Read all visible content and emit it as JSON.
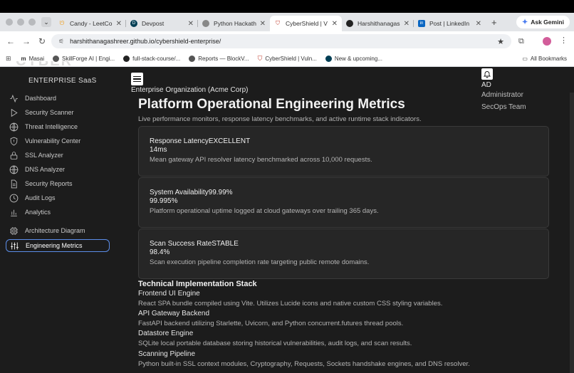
{
  "browser": {
    "tabs": [
      {
        "title": "Candy - LeetCo",
        "icon": "leetcode-icon"
      },
      {
        "title": "Devpost",
        "icon": "devpost-icon"
      },
      {
        "title": "Python Hackath",
        "icon": "python-icon"
      },
      {
        "title": "CyberShield | V",
        "icon": "shield-icon"
      },
      {
        "title": "Harshithanagas",
        "icon": "github-icon"
      },
      {
        "title": "Post | LinkedIn",
        "icon": "linkedin-icon"
      }
    ],
    "active_tab": 3,
    "ask_gemini": "Ask Gemini",
    "url": "harshithanagashreer.github.io/cybershield-enterprise/",
    "bookmarks": [
      "Masai",
      "SkillForge AI | Engi...",
      "full-stack-course/...",
      "Reports — BlockV...",
      "CyberShield | Vuln...",
      "New & upcoming..."
    ],
    "all_bookmarks": "All Bookmarks"
  },
  "sidebar": {
    "brand_sub": "ENTERPRISE SaaS",
    "items": [
      {
        "label": "Dashboard",
        "icon": "activity-icon"
      },
      {
        "label": "Security Scanner",
        "icon": "play-icon"
      },
      {
        "label": "Threat Intelligence",
        "icon": "globe-icon"
      },
      {
        "label": "Vulnerability Center",
        "icon": "alert-shield-icon"
      },
      {
        "label": "SSL Analyzer",
        "icon": "lock-icon"
      },
      {
        "label": "DNS Analyzer",
        "icon": "globe-icon"
      },
      {
        "label": "Security Reports",
        "icon": "file-icon"
      },
      {
        "label": "Audit Logs",
        "icon": "clock-icon"
      },
      {
        "label": "Analytics",
        "icon": "bar-chart-icon"
      },
      {
        "label": "Architecture Diagram",
        "icon": "cpu-icon"
      },
      {
        "label": "Engineering Metrics",
        "icon": "sliders-icon"
      }
    ],
    "active_index": 10
  },
  "header": {
    "org": "Enterprise Organization (Acme Corp)",
    "user_initials": "AD",
    "user_role": "Administrator",
    "user_team": "SecOps Team"
  },
  "page": {
    "title": "Platform Operational Engineering Metrics",
    "subtitle": "Live performance monitors, response latency benchmarks, and active runtime stack indicators.",
    "cards": [
      {
        "title": "Response LatencyEXCELLENT",
        "value": "14ms",
        "desc": "Mean gateway API resolver latency benchmarked across 10,000 requests."
      },
      {
        "title": "System Availability99.99%",
        "value": "99.995%",
        "desc": "Platform operational uptime logged at cloud gateways over trailing 365 days."
      },
      {
        "title": "Scan Success RateSTABLE",
        "value": "98.4%",
        "desc": "Scan execution pipeline completion rate targeting public remote domains."
      }
    ],
    "stack_title": "Technical Implementation Stack",
    "stack": [
      {
        "name": "Frontend UI Engine",
        "desc": "React SPA bundle compiled using Vite. Utilizes Lucide icons and native custom CSS styling variables."
      },
      {
        "name": "API Gateway Backend",
        "desc": "FastAPI backend utilizing Starlette, Uvicorn, and Python concurrent.futures thread pools."
      },
      {
        "name": "Datastore Engine",
        "desc": "SQLite local portable database storing historical vulnerabilities, audit logs, and scan results."
      },
      {
        "name": "Scanning Pipeline",
        "desc": "Python built-in SSL context modules, Cryptography, Requests, Sockets handshake engines, and DNS resolver."
      }
    ]
  }
}
